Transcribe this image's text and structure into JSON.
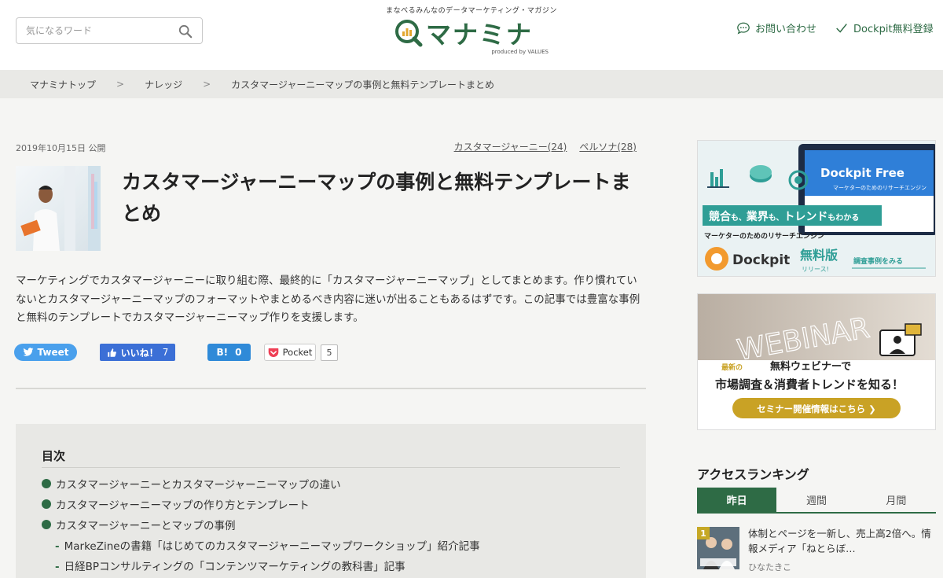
{
  "header": {
    "search_placeholder": "気になるワード",
    "tagline": "まなべるみんなのデータマーケティング・マガジン",
    "logo_text": "マナミナ",
    "logo_sub": "produced by VALUES",
    "contact_label": "お問い合わせ",
    "signup_label": "Dockpit無料登録",
    "accent_color": "#2e6b45"
  },
  "breadcrumb": {
    "items": [
      "マナミナトップ",
      "ナレッジ",
      "カスタマージャーニーマップの事例と無料テンプレートまとめ"
    ],
    "separator": ">"
  },
  "article": {
    "date": "2019年10月15日 公開",
    "tags": [
      "カスタマージャーニー(24)",
      "ペルソナ(28)"
    ],
    "title": "カスタマージャーニーマップの事例と無料テンプレートまとめ",
    "lead": "マーケティングでカスタマージャーニーに取り組む際、最終的に「カスタマージャーニーマップ」としてまとめます。作り慣れていないとカスタマージャーニーマップのフォーマットやまとめるべき内容に迷いが出ることもあるはずです。この記事では豊富な事例と無料のテンプレートでカスタマージャーニーマップ作りを支援します。"
  },
  "share": {
    "tweet_label": "Tweet",
    "fb_label": "いいね！",
    "fb_count": "7",
    "hatena_label": "B!",
    "hatena_count": "0",
    "pocket_label": "Pocket",
    "pocket_count": "5"
  },
  "toc": {
    "title": "目次",
    "items": [
      "カスタマージャーニーとカスタマージャーニーマップの違い",
      "カスタマージャーニーマップの作り方とテンプレート",
      "カスタマージャーニーとマップの事例"
    ],
    "sub_items": [
      "MarkeZineの書籍「はじめてのカスタマージャーニーマップワークショップ」紹介記事",
      "日経BPコンサルティングの「コンテンツマーケティングの教科書」記事"
    ]
  },
  "banner1": {
    "product": "Dockpit Free",
    "product_sub": "マーケターのためのリサーチエンジン",
    "headline_a": "競合",
    "headline_b": "も、",
    "headline_c": "業界",
    "headline_d": "も、",
    "headline_e": "トレンド",
    "headline_f": "もわかる",
    "sub": "マーケターのためのリサーチエンジン",
    "brand": "Dockpit",
    "free": "無料版",
    "release": "リリース!",
    "cta": "調査事例をみる"
  },
  "banner2": {
    "bg_word": "WEBINAR",
    "latest": "最新の",
    "line1": "無料ウェビナーで",
    "line2": "市場調査＆消費者トレンドを知る！",
    "cta": "セミナー開催情報はこちら ❯"
  },
  "ranking": {
    "title": "アクセスランキング",
    "tabs": [
      "昨日",
      "週間",
      "月間"
    ],
    "active_tab": 0,
    "item": {
      "rank": "1",
      "text": "体制とページを一新し、売上高2倍へ。情報メディア「ねとらぼ…",
      "author": "ひなたきこ"
    }
  }
}
